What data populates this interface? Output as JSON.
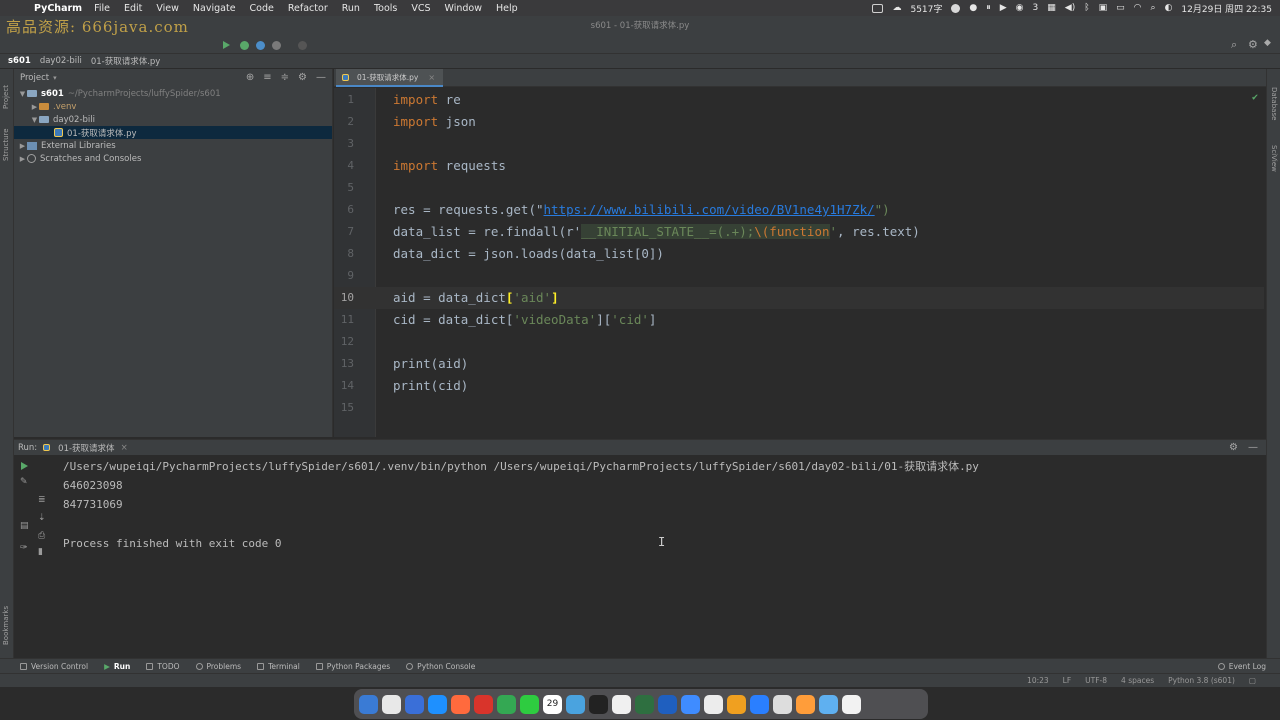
{
  "menubar": {
    "app_name": "PyCharm",
    "menus": [
      "File",
      "Edit",
      "View",
      "Navigate",
      "Code",
      "Refactor",
      "Run",
      "Tools",
      "VCS",
      "Window",
      "Help"
    ],
    "word_count": "5517字",
    "badge": "3",
    "datetime": "12月29日 周四  22:35"
  },
  "window": {
    "title": "s601 - 01-获取请求体.py",
    "watermark": "高品资源: 666java.com"
  },
  "breadcrumb": [
    "s601",
    "day02-bili",
    "01-获取请求体.py"
  ],
  "left_stripe": [
    "Project",
    "Structure",
    "Bookmarks"
  ],
  "right_stripe": [
    "Database",
    "SciView"
  ],
  "project": {
    "header": "Project",
    "tree": [
      {
        "label": "s601",
        "path": "~/PycharmProjects/luffySpider/s601"
      },
      {
        "label": ".venv"
      },
      {
        "label": "day02-bili"
      },
      {
        "label": "01-获取请求体.py"
      },
      {
        "label": "External Libraries"
      },
      {
        "label": "Scratches and Consoles"
      }
    ]
  },
  "editor": {
    "tab": "01-获取请求体.py",
    "current_line": 10,
    "line_numbers": [
      "1",
      "2",
      "3",
      "4",
      "5",
      "6",
      "7",
      "8",
      "9",
      "10",
      "11",
      "12",
      "13",
      "14",
      "15"
    ],
    "code": {
      "l1_kw": "import",
      "l1_rest": " re",
      "l2_kw": "import",
      "l2_rest": " json",
      "l4_kw": "import",
      "l4_rest": " requests",
      "l6_pre": "res = requests.get(\"",
      "l6_url": "https://www.bilibili.com/video/BV1ne4y1H7Zk/",
      "l6_post": "\")",
      "l7_pre": "data_list = re.findall(r'",
      "l7_rx1": "__INITIAL_STATE__=(.+);",
      "l7_rx2": "\\(function",
      "l7_post1": "'",
      "l7_post2": ", res.text)",
      "l8": "data_dict = json.loads(data_list[0])",
      "l10_pre": "aid = data_dict",
      "l10_b1": "[",
      "l10_str": "'aid'",
      "l10_b2": "]",
      "l11_pre": "cid = data_dict[",
      "l11_s1": "'videoData'",
      "l11_mid": "][",
      "l11_s2": "'cid'",
      "l11_post": "]",
      "l13": "print(aid)",
      "l14": "print(cid)"
    }
  },
  "run": {
    "label": "Run:",
    "tab": "01-获取请求体",
    "output": [
      "/Users/wupeiqi/PycharmProjects/luffySpider/s601/.venv/bin/python /Users/wupeiqi/PycharmProjects/luffySpider/s601/day02-bili/01-获取请求体.py",
      "646023098",
      "847731069",
      "",
      "Process finished with exit code 0"
    ]
  },
  "bottom_tools": {
    "items": [
      "Version Control",
      "Run",
      "TODO",
      "Problems",
      "Terminal",
      "Python Packages",
      "Python Console"
    ],
    "event_log": "Event Log"
  },
  "status": {
    "position": "10:23",
    "line_sep": "LF",
    "encoding": "UTF-8",
    "indent": "4 spaces",
    "interpreter": "Python 3.8 (s601)"
  },
  "dock": {
    "calendar_day": "29",
    "colors": [
      "#3a7bd5",
      "#e8e8e8",
      "#3a6fd8",
      "#1e90ff",
      "#ff6a3d",
      "#d9342b",
      "#34a853",
      "#2ecc40",
      "#e03434",
      "#4aa3df",
      "#222222",
      "#f0f0f0",
      "#2e6f40",
      "#1f5fbf",
      "#3f8cff",
      "#ececec",
      "#f0a020",
      "#2a7fff",
      "#dddddd",
      "#ff9d3a",
      "#5fb0f0",
      "#f2f2f2"
    ]
  }
}
